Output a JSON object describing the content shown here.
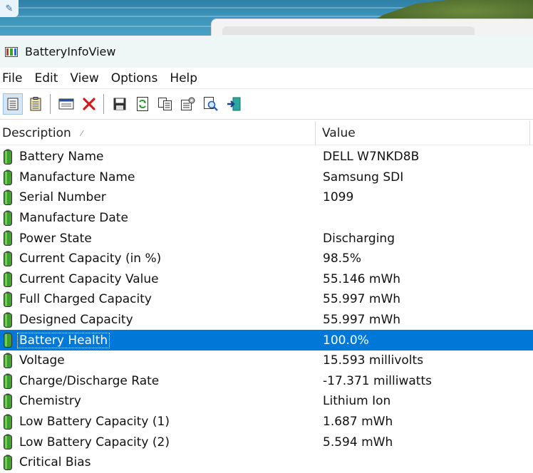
{
  "window": {
    "title": "BatteryInfoView"
  },
  "menu": [
    "File",
    "Edit",
    "View",
    "Options",
    "Help"
  ],
  "toolbar": {
    "buttons": [
      {
        "name": "view-details-button",
        "icon": "properties-page-icon",
        "active": true
      },
      {
        "name": "view-list-button",
        "icon": "clipboard-list-icon",
        "active": false
      },
      {
        "name": "window-button",
        "icon": "window-icon",
        "active": false
      },
      {
        "name": "delete-button",
        "icon": "red-x-icon",
        "active": false
      },
      {
        "name": "save-button",
        "icon": "floppy-disk-icon",
        "active": false
      },
      {
        "name": "refresh-button",
        "icon": "refresh-icon",
        "active": false
      },
      {
        "name": "copy-button",
        "icon": "copy-icon",
        "active": false
      },
      {
        "name": "properties-button",
        "icon": "properties-icon",
        "active": false
      },
      {
        "name": "find-button",
        "icon": "find-icon",
        "active": false
      },
      {
        "name": "exit-button",
        "icon": "exit-icon",
        "active": false
      }
    ]
  },
  "columns": {
    "description": "Description",
    "value": "Value"
  },
  "rows": [
    {
      "label": "Battery Name",
      "value": "DELL W7NKD8B"
    },
    {
      "label": "Manufacture Name",
      "value": "Samsung SDI"
    },
    {
      "label": "Serial Number",
      "value": "1099"
    },
    {
      "label": "Manufacture Date",
      "value": ""
    },
    {
      "label": "Power State",
      "value": "Discharging"
    },
    {
      "label": "Current Capacity (in %)",
      "value": "98.5%"
    },
    {
      "label": "Current Capacity Value",
      "value": "55.146 mWh"
    },
    {
      "label": "Full Charged Capacity",
      "value": "55.997 mWh"
    },
    {
      "label": "Designed Capacity",
      "value": "55.997 mWh"
    },
    {
      "label": "Battery Health",
      "value": "100.0%",
      "selected": true
    },
    {
      "label": "Voltage",
      "value": "15.593 millivolts"
    },
    {
      "label": "Charge/Discharge Rate",
      "value": "-17.371 milliwatts"
    },
    {
      "label": "Chemistry",
      "value": "Lithium Ion"
    },
    {
      "label": "Low Battery Capacity (1)",
      "value": "1.687 mWh"
    },
    {
      "label": "Low Battery Capacity (2)",
      "value": "5.594 mWh"
    },
    {
      "label": "Critical Bias",
      "value": ""
    }
  ],
  "colors": {
    "selection": "#0078d7",
    "battery_green": "#3f9f2f"
  }
}
